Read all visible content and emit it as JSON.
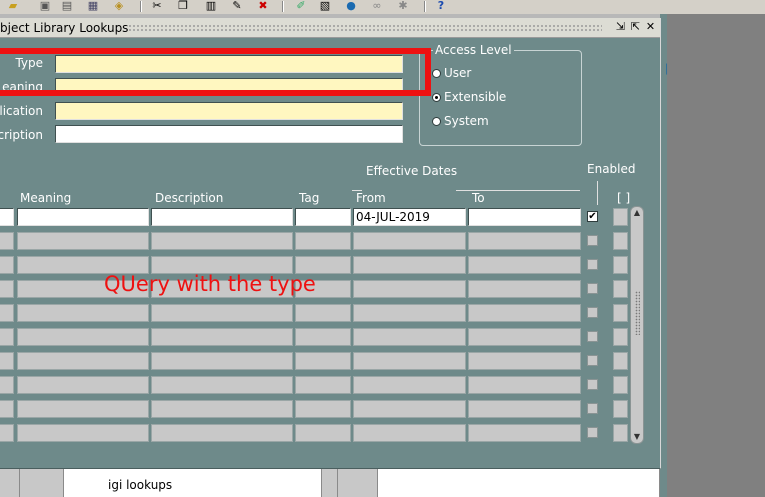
{
  "window": {
    "title": "bject Library Lookups"
  },
  "toolbar": {
    "icons": [
      "save-icon",
      "new-icon",
      "open-icon",
      "print-icon",
      "help-icon",
      "cut-icon",
      "copy-icon",
      "paste-icon",
      "clear-icon",
      "delete-icon",
      "edit-icon",
      "attach-icon",
      "globe-icon",
      "link-icon",
      "tools-icon",
      "question-icon"
    ]
  },
  "header": {
    "type_label": "Type",
    "meaning_label": "eaning",
    "application_label": "plication",
    "description_label": "scription",
    "type_value": "",
    "meaning_value": "",
    "application_value": "",
    "description_value": ""
  },
  "access_level": {
    "title": "Access Level",
    "options": [
      {
        "label": "User",
        "selected": false
      },
      {
        "label": "Extensible",
        "selected": true
      },
      {
        "label": "System",
        "selected": false
      }
    ]
  },
  "grid": {
    "effective_dates_label": "Effective Dates",
    "enabled_label": "Enabled",
    "brackets": "[ ]",
    "columns": {
      "meaning": "Meaning",
      "description": "Description",
      "tag": "Tag",
      "from": "From",
      "to": "To"
    },
    "first_row": {
      "code": "",
      "meaning": "",
      "description": "",
      "tag": "",
      "from": "04-JUL-2019",
      "to": "",
      "enabled": true
    },
    "empty_row_count": 9
  },
  "annotation": "QUery with the type",
  "background": {
    "lookups_text": "igi lookups"
  },
  "colors": {
    "window_bg": "#6e8a8a",
    "required_field": "#fff7c0",
    "highlight": "#ee1111"
  }
}
